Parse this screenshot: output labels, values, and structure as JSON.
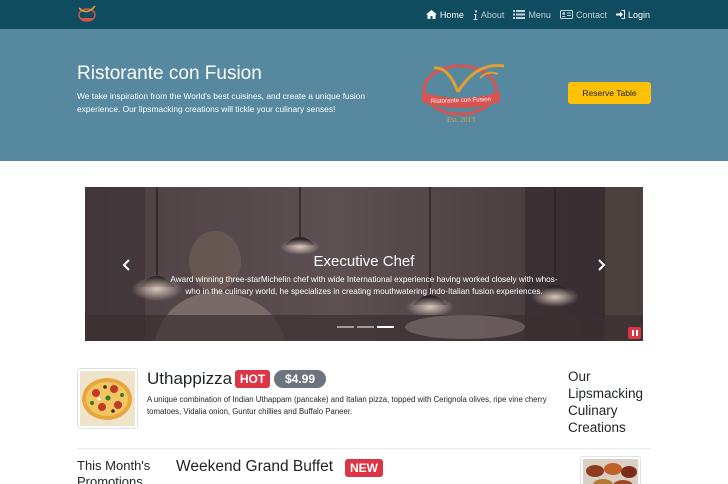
{
  "navbar": {
    "logo_icon": "restaurant-logo",
    "links": [
      {
        "label": "Home",
        "icon": "home-icon",
        "active": true
      },
      {
        "label": "About",
        "icon": "info-icon",
        "active": false
      },
      {
        "label": "Menu",
        "icon": "list-icon",
        "active": false
      },
      {
        "label": "Contact",
        "icon": "address-card-icon",
        "active": false
      }
    ],
    "login": {
      "label": "Login",
      "icon": "sign-in-icon"
    }
  },
  "jumbotron": {
    "title": "Ristorante con Fusion",
    "text": "We take inspiration from the World's best cuisines, and create a unique fusion experience. Our lipsmacking creations will tickle your culinary senses!",
    "logo": {
      "banner_text": "Ristorante con Fusion",
      "established": "Est. 2013"
    },
    "reserve_button": "Reserve Table"
  },
  "carousel": {
    "slide_title": "Executive Chef",
    "slide_text": "Award winning three-starMichelin chef with wide International experience having worked closely with whos-who in the culinary world, he specializes in creating mouthwatering Indo-Italian fusion experiences.",
    "indicator_count": 3,
    "active_indicator": 3,
    "prev_icon": "chevron-left-icon",
    "next_icon": "chevron-right-icon",
    "pause_icon": "pause-icon"
  },
  "featured_dish": {
    "name": "Uthappizza",
    "hot_badge": "HOT",
    "price": "$4.99",
    "description": "A unique combination of Indian Uthappam (pancake) and Italian pizza, topped with Cerignola olives, ripe vine cherry tomatoes, Vidalia onion, Guntur chillies and Buffalo Paneer."
  },
  "side_heading": "Our Lipsmacking Culinary Creations",
  "promotions": {
    "heading": "This Month's Promotions",
    "title": "Weekend Grand Buffet",
    "new_badge": "NEW"
  },
  "colors": {
    "navbar": "#0f4c60",
    "jumbotron": "#5689a0",
    "accent_yellow": "#ffc107",
    "danger": "#dc3545",
    "secondary": "#6c757d"
  }
}
